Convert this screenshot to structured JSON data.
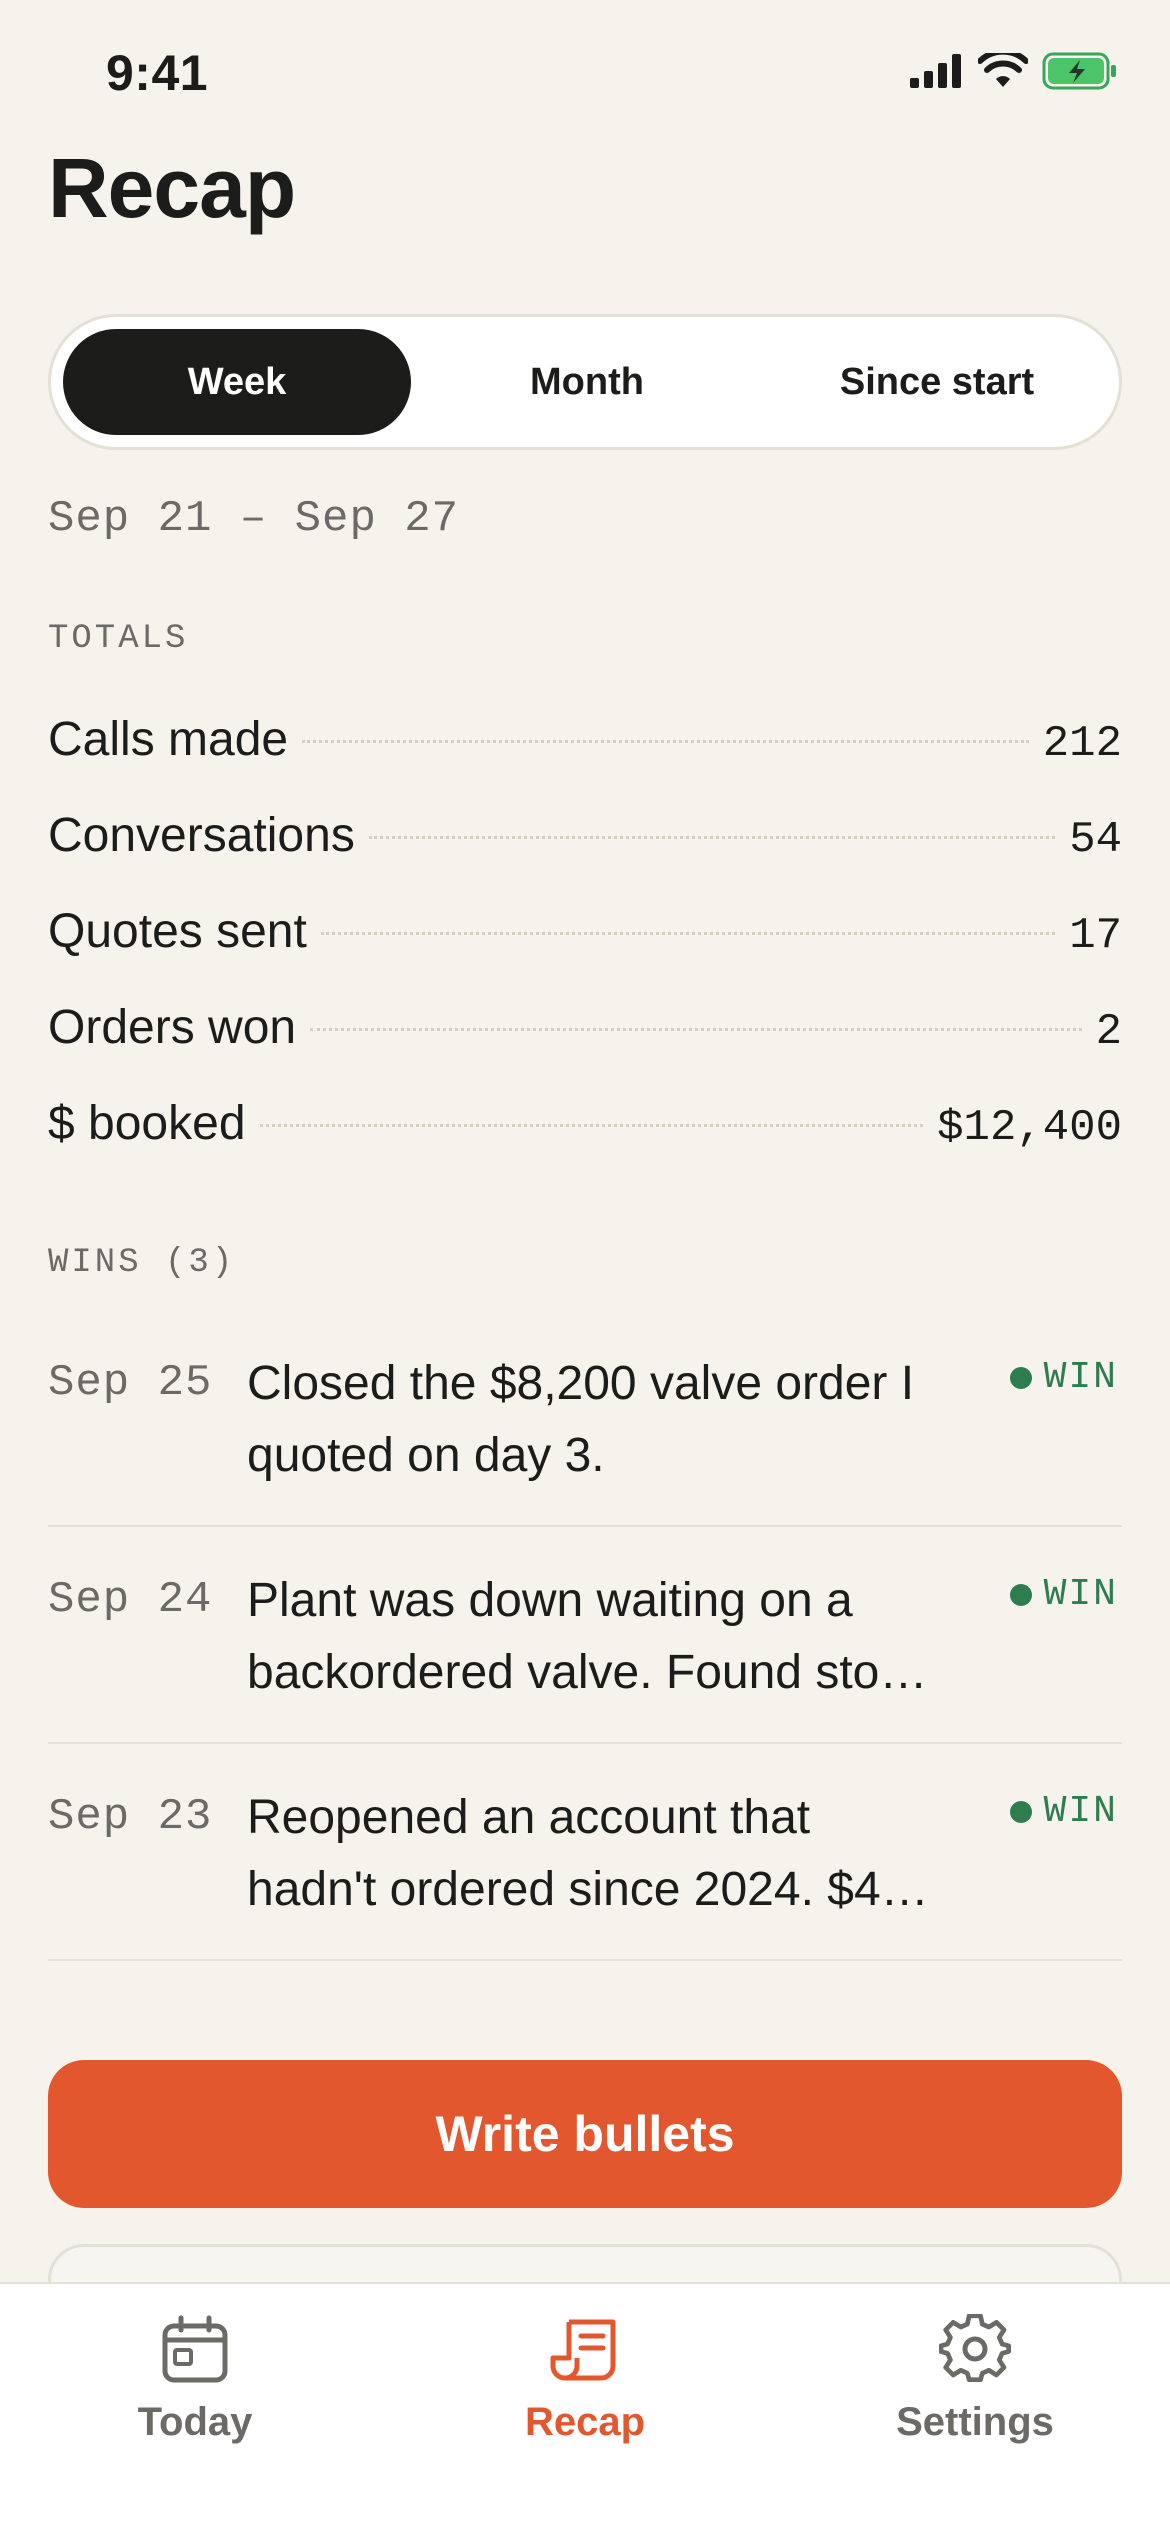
{
  "status_bar": {
    "time": "9:41"
  },
  "header": {
    "title": "Recap"
  },
  "segments": [
    {
      "label": "Week",
      "selected": true
    },
    {
      "label": "Month",
      "selected": false
    },
    {
      "label": "Since start",
      "selected": false
    }
  ],
  "date_range": "Sep 21 – Sep 27",
  "totals": {
    "section_label": "TOTALS",
    "rows": [
      {
        "label": "Calls made",
        "value": "212"
      },
      {
        "label": "Conversations",
        "value": "54"
      },
      {
        "label": "Quotes sent",
        "value": "17"
      },
      {
        "label": "Orders won",
        "value": "2"
      },
      {
        "label": "$ booked",
        "value": "$12,400"
      }
    ]
  },
  "wins": {
    "section_label": "WINS (3)",
    "items": [
      {
        "date": "Sep 25",
        "text_line1": "Closed the $8,200 valve order I",
        "text_line2": "quoted on day 3.",
        "badge": "WIN"
      },
      {
        "date": "Sep 24",
        "text_line1": "Plant was down waiting on a",
        "text_line2": "backordered valve. Found sto…",
        "badge": "WIN"
      },
      {
        "date": "Sep 23",
        "text_line1": "Reopened an account that",
        "text_line2": "hadn't ordered since 2024. $4…",
        "badge": "WIN"
      }
    ]
  },
  "primary_action": {
    "label": "Write bullets"
  },
  "tab_bar": {
    "items": [
      {
        "label": "Today",
        "icon": "calendar-icon",
        "active": false
      },
      {
        "label": "Recap",
        "icon": "receipt-icon",
        "active": true
      },
      {
        "label": "Settings",
        "icon": "gear-icon",
        "active": false
      }
    ]
  },
  "colors": {
    "background": "#f5f3ec",
    "accent": "#e3572e",
    "win_green": "#2f7d4f",
    "segment_active": "#1c1c1a"
  }
}
